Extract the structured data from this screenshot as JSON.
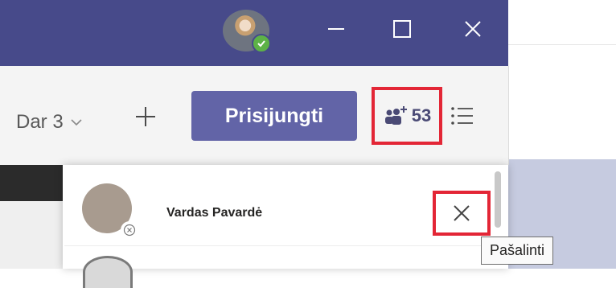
{
  "titlebar": {
    "bg_color": "#474a8a",
    "avatar": {
      "status": "available",
      "status_color": "#5db247"
    },
    "window_controls": [
      "minimize-icon",
      "maximize-icon",
      "close-icon"
    ]
  },
  "toolbar": {
    "day_label": "Dar 3",
    "join_label": "Prisijungti",
    "join_color": "#6264a7",
    "participants_count": "53",
    "highlight_color": "#e32636"
  },
  "participants_panel": {
    "items": [
      {
        "name": "Vardas Pavardė",
        "remove_tooltip": "Pašalinti"
      }
    ]
  }
}
